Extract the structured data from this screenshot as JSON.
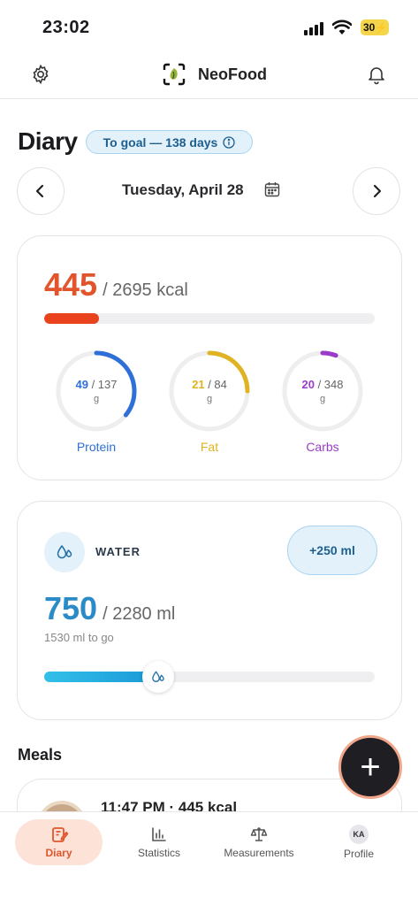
{
  "status_bar": {
    "time": "23:02",
    "battery": "30"
  },
  "header": {
    "app_name": "NeoFood"
  },
  "diary": {
    "title": "Diary",
    "goal_pill": "To goal — 138 days",
    "date": "Tuesday, April 28"
  },
  "calories": {
    "consumed": "445",
    "goal_text": "/ 2695 kcal",
    "progress": 0.165,
    "bar_color": "#e8431d"
  },
  "macros": [
    {
      "name": "Protein",
      "value": "49",
      "goal": "/ 137",
      "unit": "g",
      "fraction": 0.358,
      "color": "#2f6fd8"
    },
    {
      "name": "Fat",
      "value": "21",
      "goal": "/ 84",
      "unit": "g",
      "fraction": 0.25,
      "color": "#e0b323"
    },
    {
      "name": "Carbs",
      "value": "20",
      "goal": "/ 348",
      "unit": "g",
      "fraction": 0.057,
      "color": "#9b3cc9"
    }
  ],
  "water": {
    "label": "WATER",
    "add_button": "+250 ml",
    "amount": "750",
    "goal_text": "/ 2280 ml",
    "to_go": "1530 ml to go",
    "progress": 0.329
  },
  "meals": {
    "title": "Meals",
    "items": [
      {
        "text": "11:47 PM · 445 kcal"
      }
    ]
  },
  "fab": {
    "label": "+"
  },
  "tabbar": {
    "items": [
      {
        "label": "Diary",
        "icon": "diary-icon",
        "active": true
      },
      {
        "label": "Statistics",
        "icon": "statistics-icon"
      },
      {
        "label": "Measurements",
        "icon": "scale-icon"
      },
      {
        "label": "Profile",
        "icon": "avatar",
        "initials": "KA"
      }
    ]
  }
}
